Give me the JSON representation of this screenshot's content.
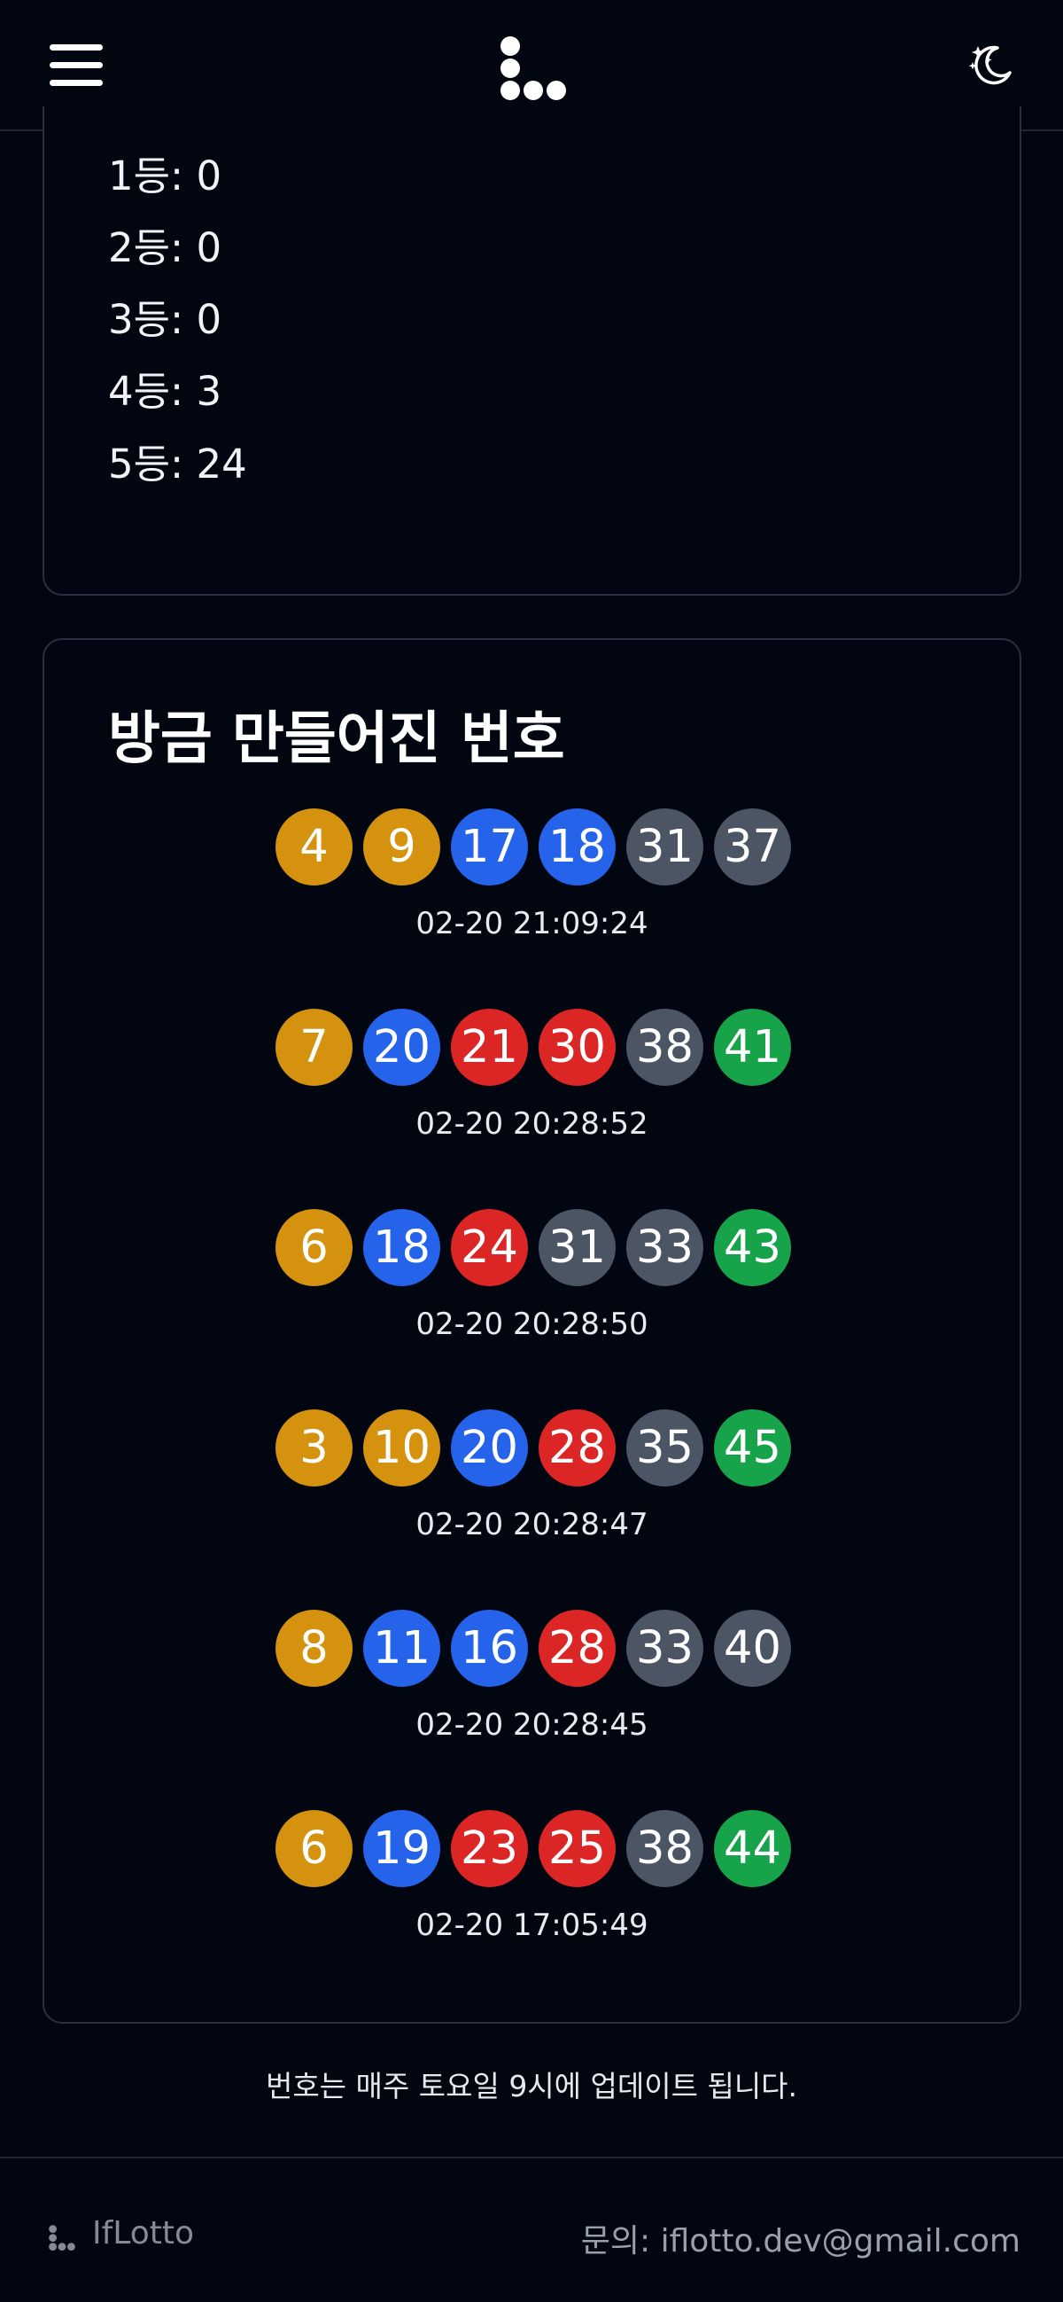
{
  "header": {
    "menu_icon": "hamburger-menu-icon",
    "logo_icon": "dots-logo-icon",
    "theme_icon": "moon-stars-icon"
  },
  "prizes": [
    {
      "label": "1등: 0"
    },
    {
      "label": "2등: 0"
    },
    {
      "label": "3등: 0"
    },
    {
      "label": "4등: 3"
    },
    {
      "label": "5등: 24"
    }
  ],
  "recent": {
    "title": "방금 만들어진 번호",
    "draws": [
      {
        "time": "02-20 21:09:24",
        "numbers": [
          4,
          9,
          17,
          18,
          31,
          37
        ]
      },
      {
        "time": "02-20 20:28:52",
        "numbers": [
          7,
          20,
          21,
          30,
          38,
          41
        ]
      },
      {
        "time": "02-20 20:28:50",
        "numbers": [
          6,
          18,
          24,
          31,
          33,
          43
        ]
      },
      {
        "time": "02-20 20:28:47",
        "numbers": [
          3,
          10,
          20,
          28,
          35,
          45
        ]
      },
      {
        "time": "02-20 20:28:45",
        "numbers": [
          8,
          11,
          16,
          28,
          33,
          40
        ]
      },
      {
        "time": "02-20 17:05:49",
        "numbers": [
          6,
          19,
          23,
          25,
          38,
          44
        ]
      }
    ]
  },
  "notice": "번호는 매주 토요일 9시에 업데이트 됩니다.",
  "footer": {
    "brand": "IfLotto",
    "contact": "문의:  iflotto.dev@gmail.com"
  },
  "colors": {
    "background": "#020611",
    "ball_1_10": "#d4920e",
    "ball_11_20": "#2563eb",
    "ball_21_30": "#dc2626",
    "ball_31_40": "#4b5563",
    "ball_41_45": "#16a34a"
  }
}
